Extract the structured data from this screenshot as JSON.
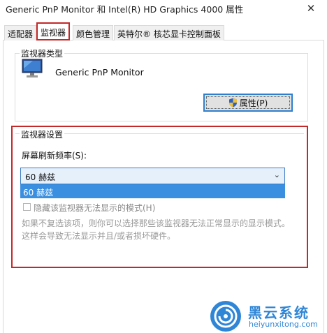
{
  "window": {
    "title": "Generic PnP Monitor 和 Intel(R) HD Graphics 4000 属性",
    "close_glyph": "✕"
  },
  "tabs": [
    {
      "label": "适配器",
      "active": false
    },
    {
      "label": "监视器",
      "active": true
    },
    {
      "label": "颜色管理",
      "active": false
    },
    {
      "label": "英特尔® 核芯显卡控制面板",
      "active": false
    }
  ],
  "monitor_type": {
    "legend": "监视器类型",
    "name": "Generic PnP Monitor",
    "properties_button": "属性(P)",
    "icon": "monitor-icon"
  },
  "monitor_settings": {
    "legend": "监视器设置",
    "refresh_label": "屏幕刷新频率(S):",
    "refresh_selected": "60 赫兹",
    "refresh_options": [
      "60 赫兹"
    ],
    "hide_modes_label": "隐藏该监视器无法显示的模式(H)",
    "hide_modes_checked": false,
    "description_line1": "如果不复选该项，则你可以选择那些该监视器无法正常显示的显示模式。",
    "description_line2": "这样会导致无法显示并且/或者损坏硬件。"
  },
  "watermark": {
    "name": "黑云系统",
    "url": "heiyunxitong.com"
  },
  "colors": {
    "highlight_red": "#c62828",
    "accent_blue": "#3a8fe0"
  }
}
